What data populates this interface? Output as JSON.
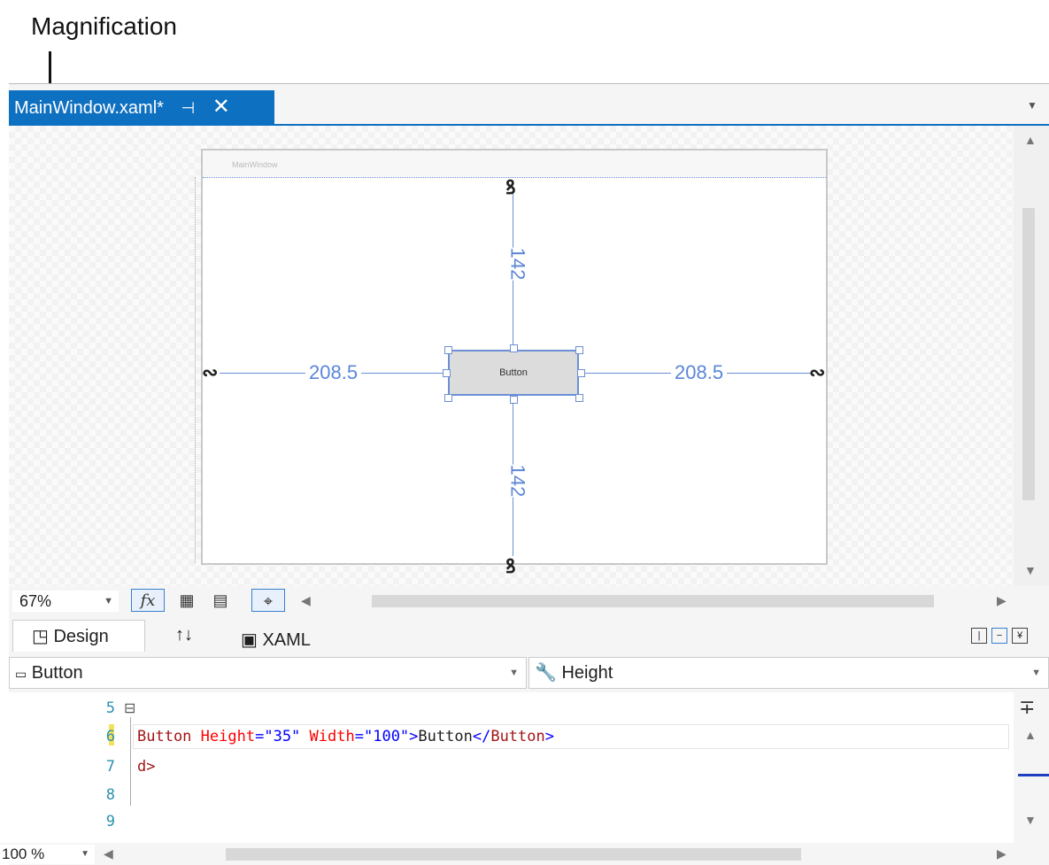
{
  "callout": {
    "label": "Magnification"
  },
  "tab": {
    "title": "MainWindow.xaml*",
    "pin_icon": "pin-icon",
    "close_icon": "close-icon"
  },
  "designer": {
    "window_title": "MainWindow",
    "margin_top": "142",
    "margin_bottom": "142",
    "margin_left": "208.5",
    "margin_right": "208.5",
    "button_text": "Button",
    "anchor_icon": "chain-link-icon"
  },
  "toolbar": {
    "zoom_value": "67%",
    "fx_label": "fx",
    "icons": [
      "grid-icon",
      "snap-grid-icon",
      "snap-lines-icon"
    ]
  },
  "view_tabs": {
    "design": "Design",
    "swap": "↑↓",
    "xaml": "XAML"
  },
  "nav_bar": {
    "element": "Button",
    "member": "Height"
  },
  "code": {
    "lines": [
      {
        "num": "5",
        "text": ""
      },
      {
        "num": "6",
        "tag_open": "Button",
        "attr1": "Height",
        "val1": "\"35\"",
        "attr2": "Width",
        "val2": "\"100\"",
        "content": "Button",
        "tag_close": "Button"
      },
      {
        "num": "7",
        "text": "d>"
      },
      {
        "num": "8",
        "text": ""
      },
      {
        "num": "9",
        "text": ""
      }
    ]
  },
  "status": {
    "zoom_value": "100 %"
  },
  "colors": {
    "accent": "#0e70c0",
    "guide": "#6c8fd6"
  }
}
